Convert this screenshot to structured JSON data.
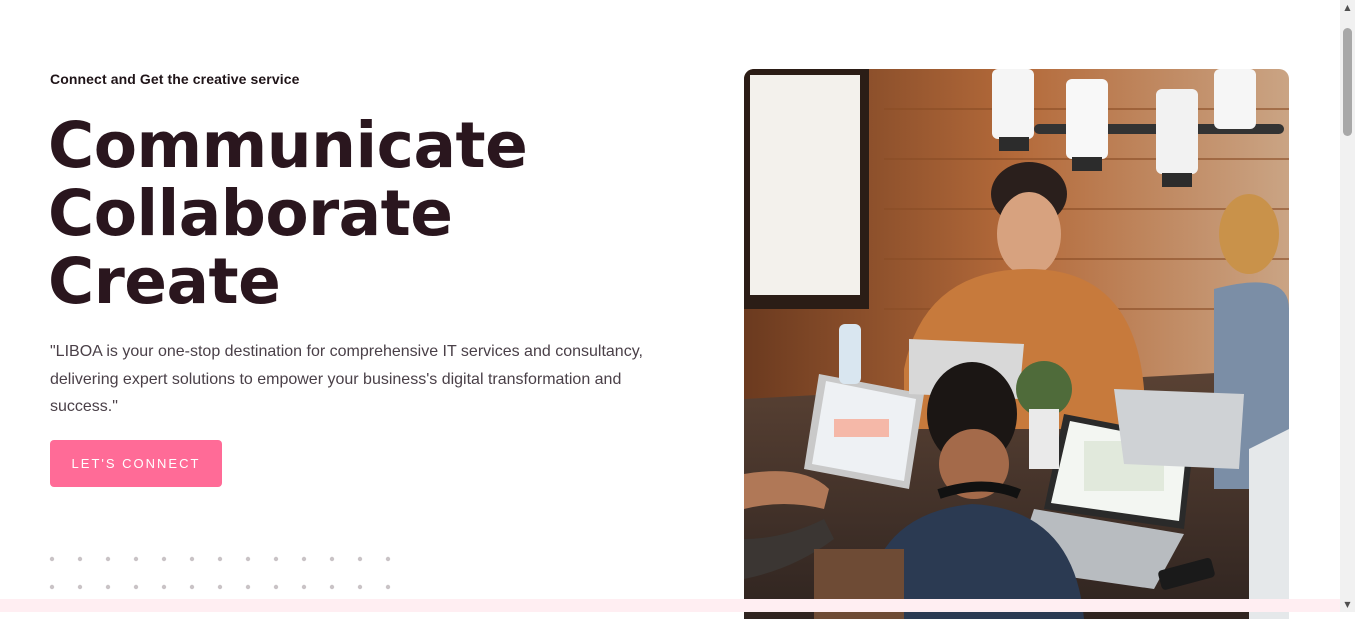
{
  "hero": {
    "eyebrow": "Connect and Get the creative service",
    "headline": [
      "Communicate",
      "Collaborate",
      "Create"
    ],
    "description": "\"LIBOA is your one-stop destination for comprehensive IT services and consultancy, delivering expert solutions to empower your business's digital transformation and success.\"",
    "cta_label": "LET'S CONNECT",
    "image_alt": "team collaborating around a table with laptops"
  },
  "colors": {
    "accent": "#ff6b97",
    "heading": "#2a161e",
    "body_text": "#4a4048",
    "bottom_strip": "#ffeef2"
  },
  "icons": {
    "scroll_up": "▲",
    "scroll_down": "▼"
  }
}
